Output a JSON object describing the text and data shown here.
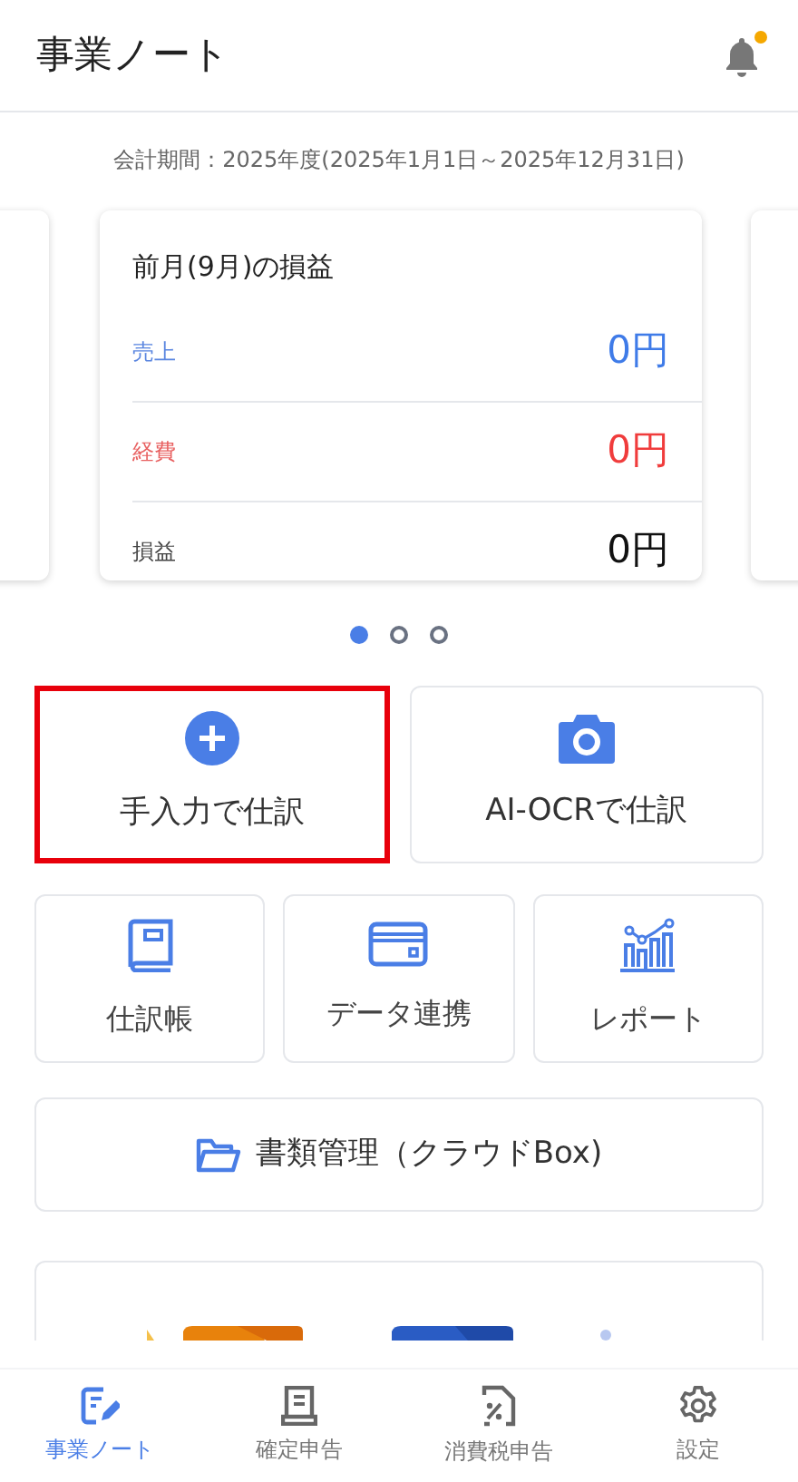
{
  "header": {
    "title": "事業ノート",
    "notification": true
  },
  "period": "会計期間：2025年度(2025年1月1日～2025年12月31日)",
  "summary_card": {
    "title": "前月(9月)の損益",
    "rows": [
      {
        "kind": "sales",
        "label": "売上",
        "value": "0円"
      },
      {
        "kind": "expense",
        "label": "経費",
        "value": "0円"
      },
      {
        "kind": "profit",
        "label": "損益",
        "value": "0円"
      }
    ]
  },
  "pager": [
    {
      "selected": true
    },
    {
      "selected": false
    },
    {
      "selected": false
    }
  ],
  "main_actions": [
    {
      "label": "手入力で仕訳",
      "highlighted": true
    },
    {
      "label": "AI-OCRで仕訳",
      "highlighted": false
    }
  ],
  "sub_actions": [
    {
      "label": "仕訳帳"
    },
    {
      "label": "データ連携"
    },
    {
      "label": "レポート"
    }
  ],
  "storage_button": {
    "label": "書類管理（クラウドBox)"
  },
  "bottom_nav": [
    {
      "label": "事業ノート",
      "selected": true
    },
    {
      "label": "確定申告",
      "selected": false
    },
    {
      "label": "消費税申告",
      "selected": false
    },
    {
      "label": "設定",
      "selected": false
    }
  ]
}
